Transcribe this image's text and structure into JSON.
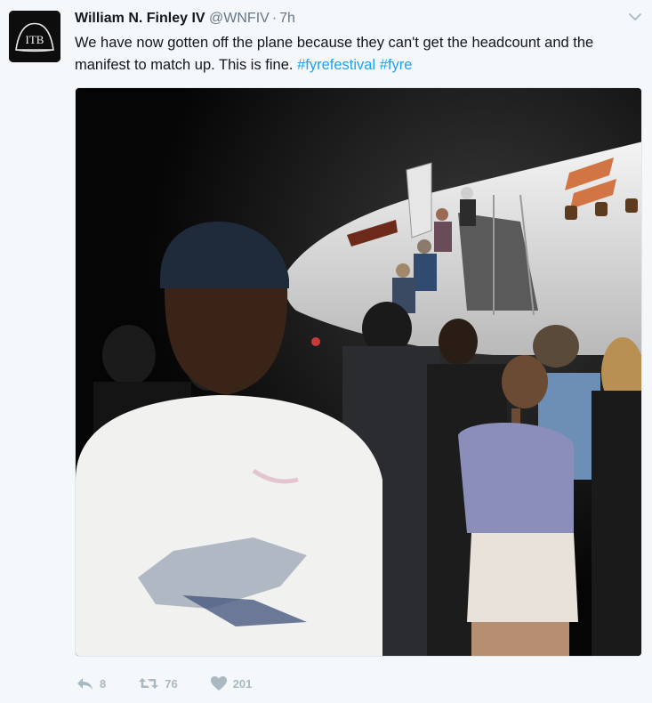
{
  "tweet": {
    "avatar_icon": "itb-logo-icon",
    "avatar_text": "ITB",
    "author": {
      "name": "William N. Finley IV",
      "handle": "@WNFIV",
      "separator": "·",
      "time": "7h"
    },
    "text": {
      "body": "We have now gotten off the plane because they can't get the headcount and the manifest to match up. This is fine. ",
      "hashtags": [
        "#fyrefestival",
        "#fyre"
      ]
    },
    "media_icon": "photo-of-passengers-leaving-plane-at-night",
    "actions": {
      "reply": {
        "icon": "reply-icon",
        "count": "8"
      },
      "retweet": {
        "icon": "retweet-icon",
        "count": "76"
      },
      "like": {
        "icon": "heart-icon",
        "count": "201"
      }
    },
    "menu_icon": "chevron-down-icon"
  },
  "colors": {
    "background": "#f5f8fa",
    "text": "#14171a",
    "secondary": "#657786",
    "hashtag": "#1da1f2",
    "action": "#aab8c2"
  }
}
